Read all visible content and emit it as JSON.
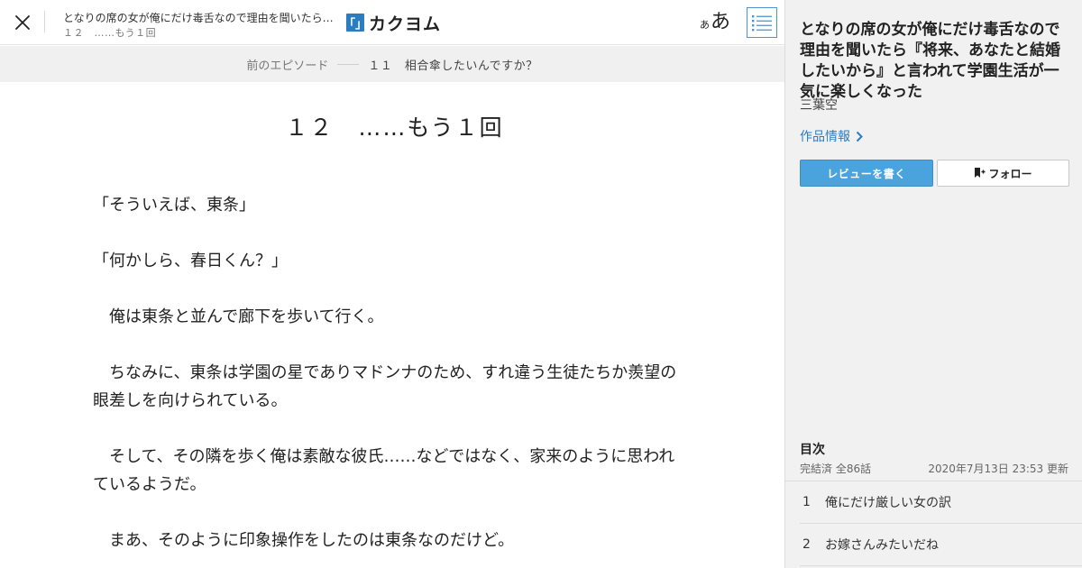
{
  "header": {
    "work_title_short": "となりの席の女が俺にだけ毒舌なので理由を聞いたら『将来、あなたと結婚したいから』と言われて学園生活が一気に楽しくなった",
    "episode_sub": "１２　……もう１回",
    "logo_mark": "「」",
    "logo_text": "カクヨム",
    "font_size_small": "あ",
    "font_size_big": "あ",
    "icons": {
      "close": "close-icon",
      "toc": "list-icon"
    }
  },
  "prev_episode": {
    "label": "前のエピソード",
    "title": "１１　相合傘したいんですか？"
  },
  "episode": {
    "title": "１２　……もう１回",
    "paragraphs": [
      "「そういえば、東条」",
      "",
      "「何かしら、春日くん？」",
      "",
      "　俺は東条と並んで廊下を歩いて行く。",
      "",
      "　ちなみに、東条は学園の星でありマドンナのため、すれ違う生徒たちか羨望の眼差しを向けられている。",
      "",
      "　そして、その隣を歩く俺は素敵な彼氏……などではなく、家来のように思われているようだ。",
      "",
      "　まあ、そのように印象操作をしたのは東条なのだけど。"
    ]
  },
  "sidebar": {
    "work_title": "となりの席の女が俺にだけ毒舌なので理由を聞いたら『将来、あなたと結婚したいから』と言われて学園生活が一気に楽しくなった",
    "author": "三葉空",
    "work_info_label": "作品情報",
    "review_button": "レビューを書く",
    "follow_button": "フォロー",
    "toc_heading": "目次",
    "toc_status": "完結済 全86話",
    "toc_updated": "2020年7月13日 23:53 更新",
    "toc_items": [
      {
        "num": "1",
        "title": "俺にだけ厳しい女の訳"
      },
      {
        "num": "2",
        "title": "お嫁さんみたいだね"
      }
    ]
  },
  "colors": {
    "accent": "#2c7cc1",
    "review_button_bg": "#4aa3dc",
    "sidebar_bg": "#f1f1f1",
    "prev_bar_bg": "#f0f0f0"
  }
}
